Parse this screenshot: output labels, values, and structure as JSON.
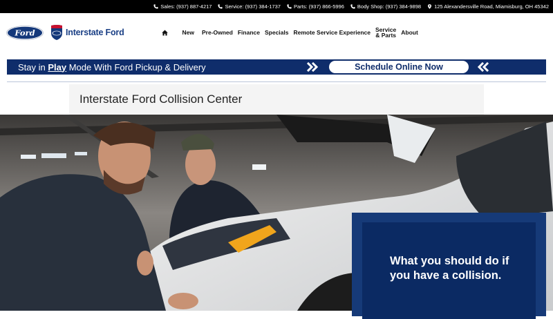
{
  "topbar": {
    "sales": "Sales: (937) 887-4217",
    "service": "Service: (937) 384-1737",
    "parts": "Parts: (937) 866-5996",
    "body_shop": "Body Shop: (937) 384-9898",
    "address": "125 Alexandersville Road, Miamisburg, OH 45342"
  },
  "header": {
    "ford_logo_text": "Ford",
    "dealer_name": "Interstate Ford"
  },
  "nav": {
    "items": [
      "New",
      "Pre-Owned",
      "Finance",
      "Specials",
      "Remote Service Experience"
    ],
    "service_parts_line1": "Service",
    "service_parts_line2": "& Parts",
    "about": "About"
  },
  "promo": {
    "text_prefix": "Stay in ",
    "text_bold": "Play",
    "text_suffix": " Mode With Ford Pickup & Delivery",
    "button_label": "Schedule Online Now"
  },
  "page": {
    "title": "Interstate Ford Collision Center"
  },
  "hero": {
    "callout_line1": "What you should do if",
    "callout_line2": "you have a collision."
  },
  "colors": {
    "brand_blue": "#0f2d6b",
    "callout_blue": "#0b2a63",
    "topbar_bg": "#000000"
  },
  "icons": [
    "phone-icon",
    "map-pin-icon",
    "home-icon",
    "chevron-right-icon",
    "chevron-left-icon"
  ]
}
